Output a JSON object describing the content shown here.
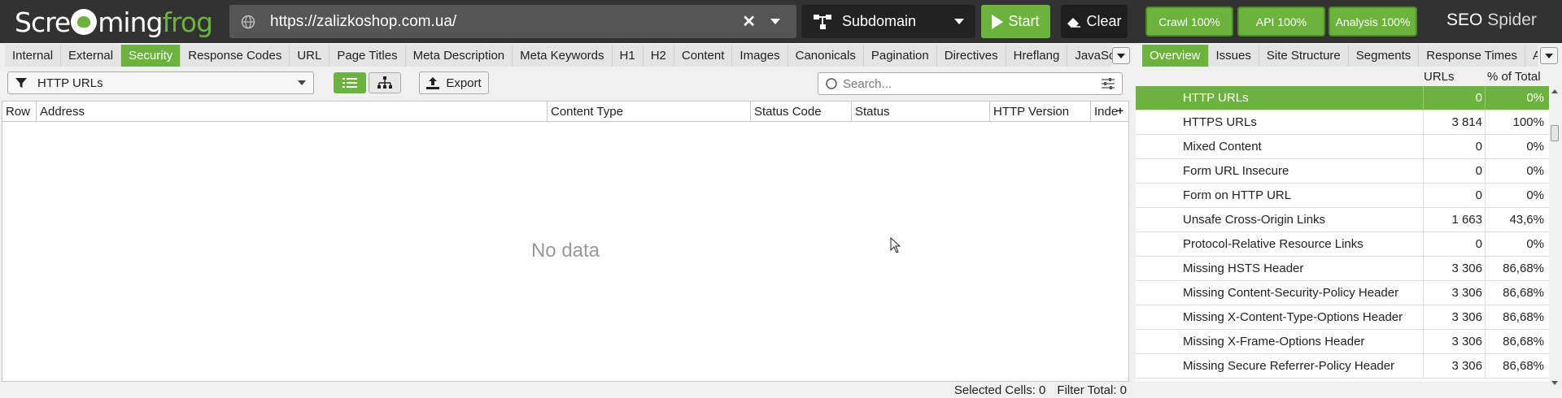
{
  "app": {
    "logo_pre": "Scre",
    "logo_mid": "ming",
    "logo_post": "frog",
    "brand_seo": "SEO",
    "brand_spider": "Spider"
  },
  "toolbar": {
    "url": "https://zalizkoshop.com.ua/",
    "mode": "Subdomain",
    "start_label": "Start",
    "clear_label": "Clear",
    "crawl_label": "Crawl 100%",
    "api_label": "API 100%",
    "analysis_label": "Analysis 100%"
  },
  "left_tabs": [
    "Internal",
    "External",
    "Security",
    "Response Codes",
    "URL",
    "Page Titles",
    "Meta Description",
    "Meta Keywords",
    "H1",
    "H2",
    "Content",
    "Images",
    "Canonicals",
    "Pagination",
    "Directives",
    "Hreflang",
    "JavaScrip"
  ],
  "left_active_tab": "Security",
  "filter": {
    "label": "HTTP URLs",
    "export_label": "Export",
    "search_placeholder": "Search..."
  },
  "grid": {
    "columns": [
      "Row",
      "Address",
      "Content Type",
      "Status Code",
      "Status",
      "HTTP Version",
      "Inde"
    ],
    "empty_text": "No data"
  },
  "status_bar": {
    "selected_cells": "Selected Cells:  0",
    "filter_total": "Filter Total:  0"
  },
  "right_tabs": [
    "Overview",
    "Issues",
    "Site Structure",
    "Segments",
    "Response Times",
    "AI"
  ],
  "right_active_tab": "Overview",
  "overview": {
    "col_urls": "URLs",
    "col_pct": "% of Total",
    "rows": [
      {
        "label": "HTTP URLs",
        "urls": "0",
        "pct": "0%"
      },
      {
        "label": "HTTPS URLs",
        "urls": "3 814",
        "pct": "100%"
      },
      {
        "label": "Mixed Content",
        "urls": "0",
        "pct": "0%"
      },
      {
        "label": "Form URL Insecure",
        "urls": "0",
        "pct": "0%"
      },
      {
        "label": "Form on HTTP URL",
        "urls": "0",
        "pct": "0%"
      },
      {
        "label": "Unsafe Cross-Origin Links",
        "urls": "1 663",
        "pct": "43,6%"
      },
      {
        "label": "Protocol-Relative Resource Links",
        "urls": "0",
        "pct": "0%"
      },
      {
        "label": "Missing HSTS Header",
        "urls": "3 306",
        "pct": "86,68%"
      },
      {
        "label": "Missing Content-Security-Policy Header",
        "urls": "3 306",
        "pct": "86,68%"
      },
      {
        "label": "Missing X-Content-Type-Options Header",
        "urls": "3 306",
        "pct": "86,68%"
      },
      {
        "label": "Missing X-Frame-Options Header",
        "urls": "3 306",
        "pct": "86,68%"
      },
      {
        "label": "Missing Secure Referrer-Policy Header",
        "urls": "3 306",
        "pct": "86,68%"
      }
    ]
  },
  "colors": {
    "accent": "#6cb33e",
    "topbar": "#323232"
  }
}
